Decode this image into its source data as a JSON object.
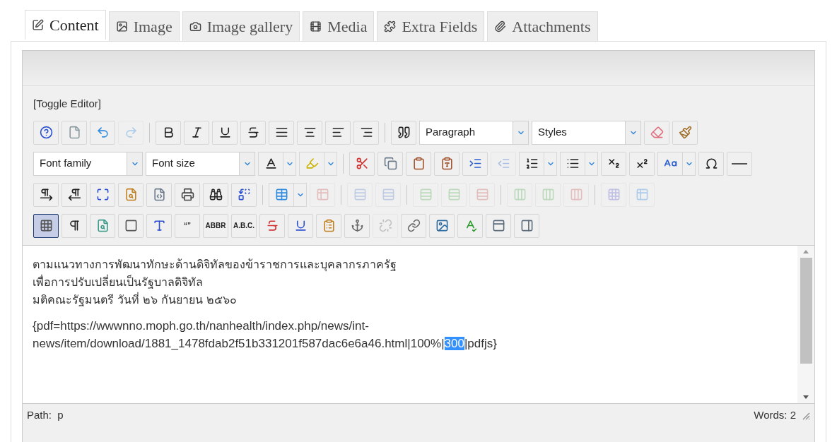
{
  "tabs": [
    {
      "label": "Content",
      "selected": true
    },
    {
      "label": "Image",
      "selected": false
    },
    {
      "label": "Image gallery",
      "selected": false
    },
    {
      "label": "Media",
      "selected": false
    },
    {
      "label": "Extra Fields",
      "selected": false
    },
    {
      "label": "Attachments",
      "selected": false
    }
  ],
  "toggle_editor": "[Toggle Editor]",
  "toolbar_rows": [
    [
      {
        "kind": "button",
        "disabled": false,
        "selected": false
      },
      {
        "kind": "button",
        "disabled": false,
        "selected": false
      },
      {
        "kind": "button",
        "disabled": false,
        "selected": false
      },
      {
        "kind": "button",
        "disabled": true,
        "selected": false
      },
      {
        "kind": "separator"
      },
      {
        "kind": "button",
        "disabled": false,
        "selected": false
      },
      {
        "kind": "button",
        "disabled": false,
        "selected": false
      },
      {
        "kind": "button",
        "disabled": false,
        "selected": false
      },
      {
        "kind": "button",
        "disabled": false,
        "selected": false
      },
      {
        "kind": "button",
        "disabled": false,
        "selected": false
      },
      {
        "kind": "button",
        "disabled": false,
        "selected": false
      },
      {
        "kind": "button",
        "disabled": false,
        "selected": false
      },
      {
        "kind": "button",
        "disabled": false,
        "selected": false
      },
      {
        "kind": "separator"
      },
      {
        "kind": "button",
        "disabled": false,
        "selected": false
      },
      {
        "kind": "select",
        "value": "Paragraph"
      },
      {
        "kind": "select",
        "value": "Styles"
      },
      {
        "kind": "button",
        "disabled": false,
        "selected": false
      },
      {
        "kind": "button",
        "disabled": false,
        "selected": false
      }
    ],
    [
      {
        "kind": "select",
        "value": "Font family"
      },
      {
        "kind": "select",
        "value": "Font size"
      },
      {
        "kind": "split",
        "disabled": false
      },
      {
        "kind": "split",
        "disabled": false
      },
      {
        "kind": "separator"
      },
      {
        "kind": "button",
        "disabled": false,
        "selected": false
      },
      {
        "kind": "button",
        "disabled": false,
        "selected": false
      },
      {
        "kind": "button",
        "disabled": false,
        "selected": false
      },
      {
        "kind": "button",
        "disabled": false,
        "selected": false
      },
      {
        "kind": "button",
        "disabled": false,
        "selected": false
      },
      {
        "kind": "button",
        "disabled": true,
        "selected": false
      },
      {
        "kind": "split",
        "disabled": false
      },
      {
        "kind": "split",
        "disabled": false
      },
      {
        "kind": "button",
        "disabled": false,
        "selected": false
      },
      {
        "kind": "button",
        "disabled": false,
        "selected": false
      },
      {
        "kind": "split",
        "disabled": false
      },
      {
        "kind": "button",
        "disabled": false,
        "selected": false
      },
      {
        "kind": "button",
        "disabled": false,
        "selected": false
      }
    ],
    [
      {
        "kind": "button",
        "disabled": false,
        "selected": false
      },
      {
        "kind": "button",
        "disabled": false,
        "selected": false
      },
      {
        "kind": "button",
        "disabled": false,
        "selected": false
      },
      {
        "kind": "button",
        "disabled": false,
        "selected": false
      },
      {
        "kind": "button",
        "disabled": false,
        "selected": false
      },
      {
        "kind": "button",
        "disabled": false,
        "selected": false
      },
      {
        "kind": "button",
        "disabled": false,
        "selected": false
      },
      {
        "kind": "button",
        "disabled": false,
        "selected": false
      },
      {
        "kind": "separator"
      },
      {
        "kind": "split",
        "disabled": false
      },
      {
        "kind": "button",
        "disabled": true,
        "selected": false
      },
      {
        "kind": "separator"
      },
      {
        "kind": "button",
        "disabled": true,
        "selected": false
      },
      {
        "kind": "button",
        "disabled": true,
        "selected": false
      },
      {
        "kind": "separator"
      },
      {
        "kind": "button",
        "disabled": true,
        "selected": false
      },
      {
        "kind": "button",
        "disabled": true,
        "selected": false
      },
      {
        "kind": "button",
        "disabled": true,
        "selected": false
      },
      {
        "kind": "separator"
      },
      {
        "kind": "button",
        "disabled": true,
        "selected": false
      },
      {
        "kind": "button",
        "disabled": true,
        "selected": false
      },
      {
        "kind": "button",
        "disabled": true,
        "selected": false
      },
      {
        "kind": "separator"
      },
      {
        "kind": "button",
        "disabled": true,
        "selected": false
      },
      {
        "kind": "button",
        "disabled": true,
        "selected": false
      }
    ],
    [
      {
        "kind": "button",
        "disabled": false,
        "selected": true
      },
      {
        "kind": "button",
        "disabled": false,
        "selected": false
      },
      {
        "kind": "button",
        "disabled": false,
        "selected": false
      },
      {
        "kind": "button",
        "disabled": false,
        "selected": false
      },
      {
        "kind": "button",
        "disabled": false,
        "selected": false
      },
      {
        "kind": "label",
        "label": "“”",
        "disabled": false
      },
      {
        "kind": "label",
        "label": "ABBR",
        "disabled": false
      },
      {
        "kind": "label",
        "label": "A.B.C.",
        "disabled": false
      },
      {
        "kind": "button",
        "disabled": false,
        "selected": false
      },
      {
        "kind": "button",
        "disabled": false,
        "selected": false
      },
      {
        "kind": "button",
        "disabled": false,
        "selected": false
      },
      {
        "kind": "button",
        "disabled": false,
        "selected": false
      },
      {
        "kind": "button",
        "disabled": true,
        "selected": false
      },
      {
        "kind": "button",
        "disabled": false,
        "selected": false
      },
      {
        "kind": "button",
        "disabled": false,
        "selected": false
      },
      {
        "kind": "button",
        "disabled": false,
        "selected": false
      },
      {
        "kind": "button",
        "disabled": false,
        "selected": false
      },
      {
        "kind": "button",
        "disabled": false,
        "selected": false
      }
    ]
  ],
  "content": {
    "lines": [
      "ตามแนวทางการพัฒนาทักษะด้านดิจิทัลของข้าราชการและบุคลากรภาครัฐ",
      "เพื่อการปรับเปลี่ยนเป็นรัฐบาลดิจิทัล",
      "มติคณะรัฐมนตรี วันที่ ๒๖ กันยายน ๒๕๖๐"
    ],
    "code_line_1": "{pdf=https://wwwnno.moph.go.th/nanhealth/index.php/news/int-",
    "code_line_2_before": "news/item/download/1881_1478fdab2f51b331201f587dac6e6a46.html|100%|",
    "selection": "300",
    "code_line_2_after": "|pdfjs}"
  },
  "status_bar": {
    "path": "Path:  p",
    "words": "Words: 2"
  }
}
